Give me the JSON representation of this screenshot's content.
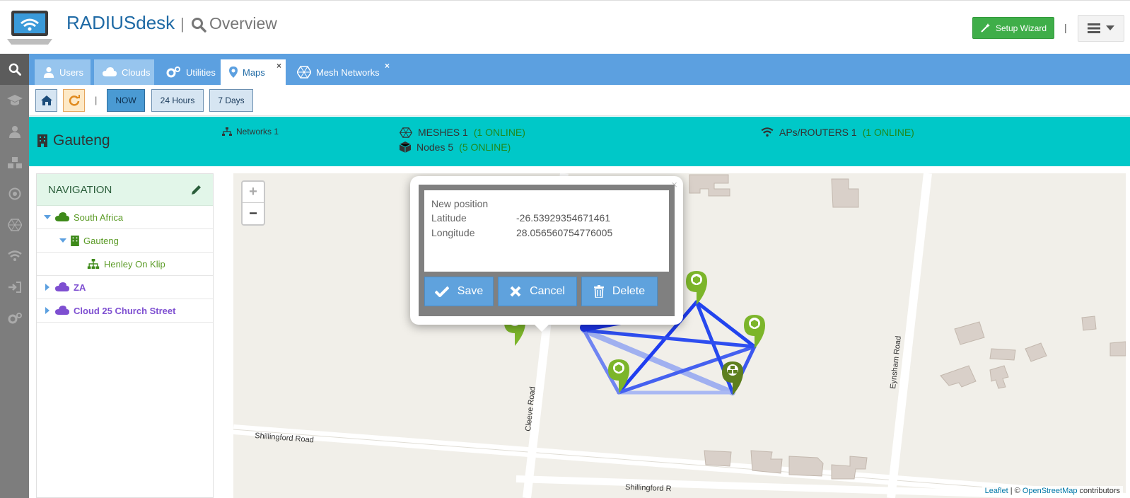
{
  "header": {
    "brand": "RADIUSdesk",
    "separator": "|",
    "page": "Overview",
    "wizard_label": "Setup Wizard",
    "pipe": "|"
  },
  "tabs": [
    {
      "label": "Users"
    },
    {
      "label": "Clouds"
    },
    {
      "label": "Utilities"
    },
    {
      "label": "Maps",
      "close": "×"
    },
    {
      "label": "Mesh Networks",
      "close": "×"
    }
  ],
  "toolbar": {
    "pipe": "|",
    "now": "NOW",
    "h24": "24 Hours",
    "d7": "7 Days"
  },
  "banner": {
    "title": "Gauteng",
    "networks": "Networks 1",
    "meshes_label": "MESHES 1",
    "meshes_online": "(1 ONLINE)",
    "nodes_label": "Nodes 5",
    "nodes_online": "(5 ONLINE)",
    "aps_label": "APs/ROUTERS 1",
    "aps_online": "(1 ONLINE)"
  },
  "navigation": {
    "title": "NAVIGATION",
    "items": [
      {
        "label": "South Africa"
      },
      {
        "label": "Gauteng"
      },
      {
        "label": "Henley On Klip"
      },
      {
        "label": "ZA"
      },
      {
        "label": "Cloud 25 Church Street"
      }
    ]
  },
  "map": {
    "zoom_in": "+",
    "zoom_out": "−",
    "roads": {
      "shillingford": "Shillingford Road",
      "shillingford2": "Shillingford R",
      "cleeve": "Cleeve Road",
      "eynsham": "Eynsham Road"
    },
    "attribution": {
      "leaflet": "Leaflet",
      "sep": " | © ",
      "osm": "OpenStreetMap",
      "suffix": " contributors"
    }
  },
  "popup": {
    "close": "×",
    "heading": "New position",
    "lat_label": "Latitude",
    "lat_value": "-26.53929354671461",
    "lng_label": "Longitude",
    "lng_value": "28.056560754776005",
    "save": "Save",
    "cancel": "Cancel",
    "delete": "Delete"
  },
  "colors": {
    "tabbar": "#5ca0e0",
    "banner": "#00c8c8",
    "wizard": "#3fae49",
    "mesh_link": "#2e55e8",
    "node_marker": "#7cb52a"
  }
}
